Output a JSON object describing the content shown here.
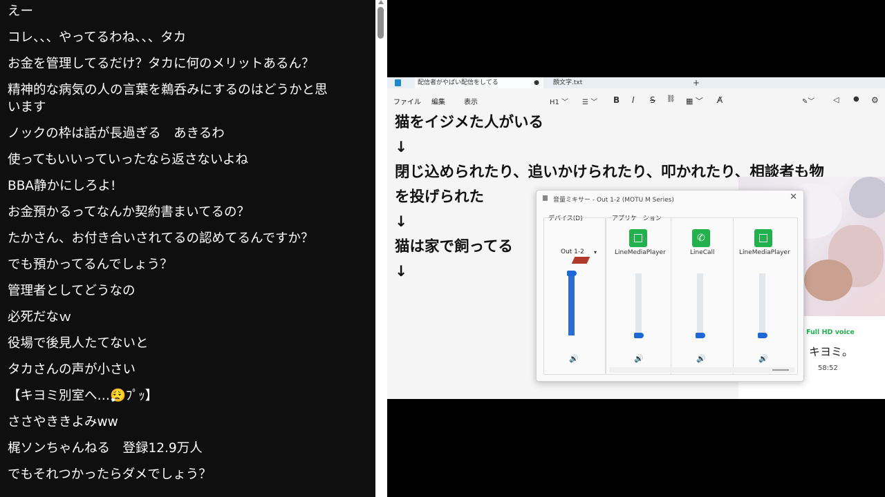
{
  "chat": {
    "messages": [
      "えー",
      "コレ、、、やってるわね、、、タカ",
      "お金を管理してるだけ？タカに何のメリットあるん？",
      "精神的な病気の人の言葉を鵜呑みにするのはどうかと思",
      "います",
      "ノックの枠は話が長過ぎる　あきるわ",
      "使ってもいいっていったなら返さないよね",
      "BBA静かにしろよ!",
      "お金預かるってなんか契約書まいてるの？",
      "たかさん、お付き合いされてるの認めてるんですか？",
      "でも預かってるんでしょう？",
      "管理者としてどうなの",
      "必死だなｗ",
      "役場で後見人たてないと",
      "タカさんの声が小さい",
      "【キヨミ別室へ…😮‍💨ﾌﾟｯ】",
      "ささやききよみww",
      "梶ソンちゃんねる　登録12.9万人",
      "でもそれつかったらダメでしょう？"
    ]
  },
  "editor": {
    "tabs": [
      {
        "label": "配信者がやばい配信をしてる",
        "modified": "●"
      },
      {
        "label": "顔文字.txt"
      }
    ],
    "new_tab": "+",
    "menu": {
      "file": "ファイル",
      "edit": "編集",
      "view": "表示"
    },
    "toolbar": {
      "heading": "H1 ﹀",
      "list": "☰ ﹀",
      "bold": "B",
      "italic": "I",
      "strike": "S",
      "link": "⛓",
      "table": "▦ ﹀",
      "clear": "A̸"
    },
    "lines": [
      "猫をイジメた人がいる",
      "↓",
      "閉じ込められたり、追いかけられたり、叩かれたり、相談者も物",
      "を投げられた",
      "↓",
      "猫は家で飼ってる",
      "↓"
    ]
  },
  "mixer": {
    "title": "音量ミキサー - Out 1-2 (MOTU M Series)",
    "close": "✕",
    "device_label": "デバイス(D)",
    "app_label": "アプリケーション",
    "device": {
      "name": "Out 1-2",
      "arrow": "▾",
      "level": 1.0
    },
    "apps": [
      {
        "name": "LineMediaPlayer",
        "icon": "square",
        "level": 0.0
      },
      {
        "name": "LineCall",
        "icon": "phone",
        "level": 0.0
      },
      {
        "name": "LineMediaPlayer",
        "icon": "square",
        "level": 0.0
      }
    ],
    "speaker_glyph": "🔊"
  },
  "profile": {
    "badge": "Full HD voice",
    "name": "キヨミ。",
    "time": "58:52"
  },
  "colors": {
    "chat_bg": "#0f0f0f",
    "accent_blue": "#1d67d6",
    "line_green": "#22b14c"
  }
}
